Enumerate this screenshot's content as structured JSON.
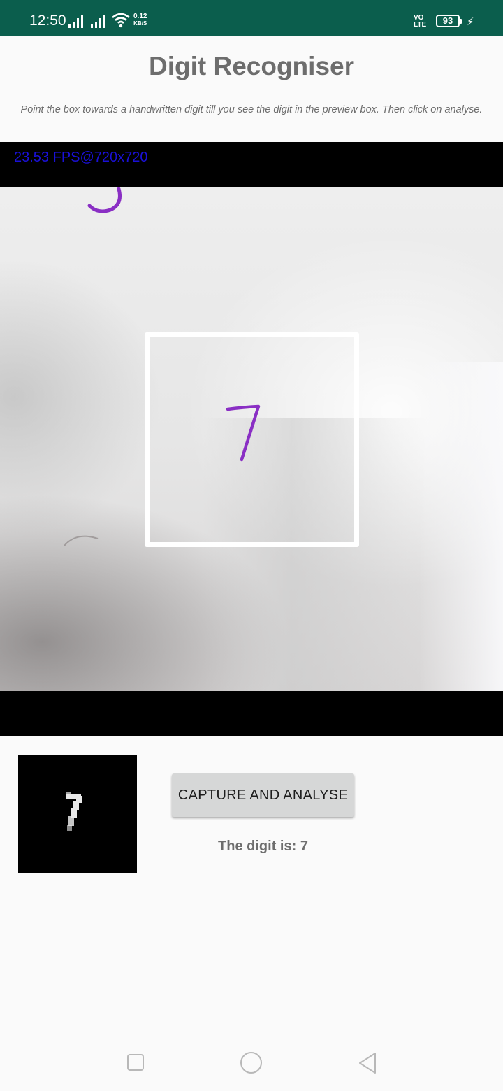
{
  "status_bar": {
    "time": "12:50",
    "net_speed_value": "0.12",
    "net_speed_unit": "KB/S",
    "volte_line1": "VO",
    "volte_line2": "LTE",
    "battery": "93"
  },
  "app": {
    "title": "Digit Recogniser",
    "instructions": "Point the box towards a handwritten digit till you see the digit in the preview box. Then click on analyse."
  },
  "camera": {
    "fps_text": "23.53 FPS@720x720",
    "visible_digit": "7",
    "ink_color": "#8a2fc4"
  },
  "result": {
    "capture_button_label": "CAPTURE AND ANALYSE",
    "digit_text": "The digit is: 7"
  },
  "colors": {
    "status_bar": "#0b5e4d",
    "fps_text": "#1a10d8",
    "button": "#d6d7d7"
  },
  "nav_bar": {
    "icons": [
      "recents-square-icon",
      "home-circle-icon",
      "back-triangle-icon"
    ]
  }
}
